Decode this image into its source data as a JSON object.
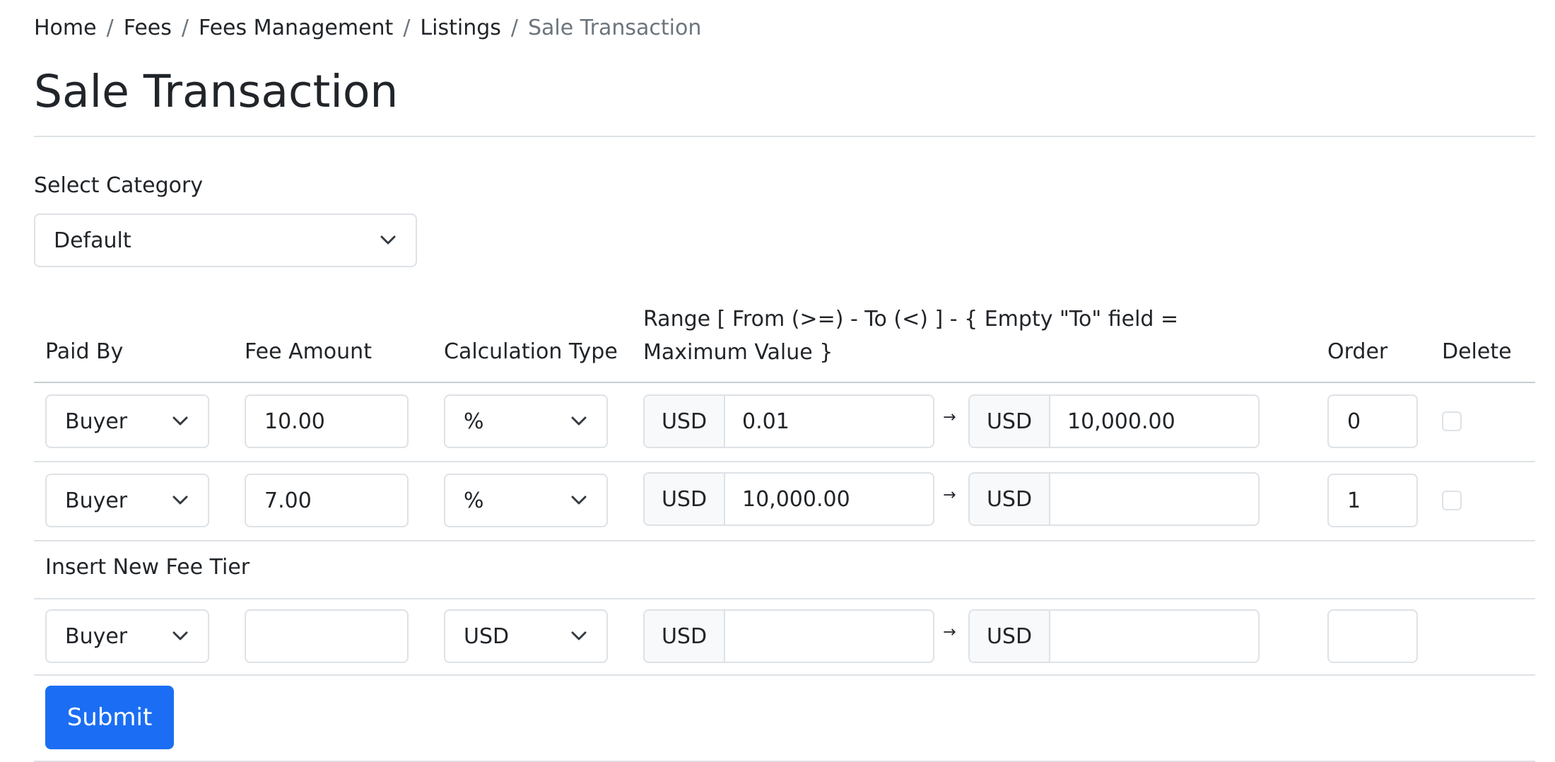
{
  "breadcrumb": {
    "items": [
      "Home",
      "Fees",
      "Fees Management",
      "Listings"
    ],
    "current": "Sale Transaction",
    "separator": "/"
  },
  "page_title": "Sale Transaction",
  "category": {
    "label": "Select Category",
    "value": "Default"
  },
  "table": {
    "headers": {
      "paid_by": "Paid By",
      "fee_amount": "Fee Amount",
      "calculation_type": "Calculation Type",
      "range": "Range [ From (>=) - To (<) ] - { Empty \"To\" field = Maximum Value }",
      "order": "Order",
      "delete": "Delete"
    },
    "rows": [
      {
        "paid_by": "Buyer",
        "fee_amount": "10.00",
        "calc_type": "%",
        "from_currency": "USD",
        "from": "0.01",
        "arrow": "→",
        "to_currency": "USD",
        "to": "10,000.00",
        "order": "0",
        "delete": false
      },
      {
        "paid_by": "Buyer",
        "fee_amount": "7.00",
        "calc_type": "%",
        "from_currency": "USD",
        "from": "10,000.00",
        "arrow": "→",
        "to_currency": "USD",
        "to": "",
        "order": "1",
        "delete": false
      }
    ],
    "insert_label": "Insert New Fee Tier",
    "new_row": {
      "paid_by": "Buyer",
      "fee_amount": "",
      "calc_type": "USD",
      "from_currency": "USD",
      "from": "",
      "arrow": "→",
      "to_currency": "USD",
      "to": "",
      "order": ""
    }
  },
  "submit_label": "Submit",
  "colors": {
    "primary": "#1b6ef3",
    "border": "#dee2e6",
    "addon_bg": "#f8f9fa",
    "muted": "#6c757d"
  }
}
